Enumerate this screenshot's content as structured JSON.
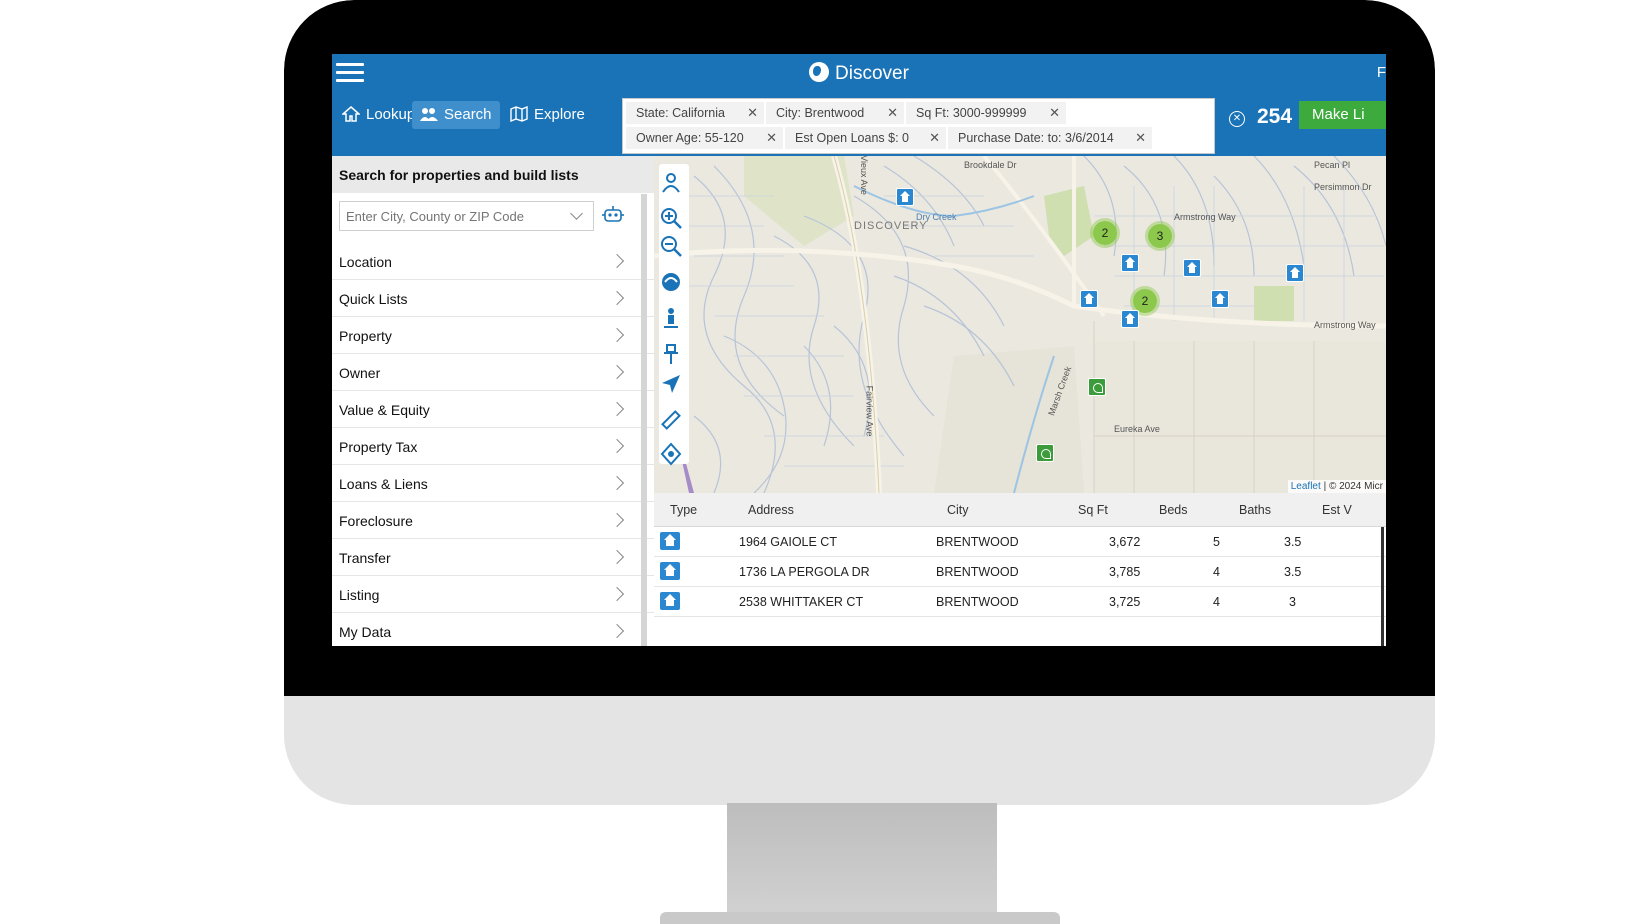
{
  "app": {
    "title": "Discover",
    "top_right_text": "F"
  },
  "nav": {
    "tabs": [
      {
        "label": "Lookup",
        "icon": "home-icon"
      },
      {
        "label": "Search",
        "icon": "search-people-icon",
        "active": true
      },
      {
        "label": "Explore",
        "icon": "map-explore-icon"
      }
    ]
  },
  "filters": [
    {
      "label": "State: California"
    },
    {
      "label": "City: Brentwood"
    },
    {
      "label": "Sq Ft: 3000-999999"
    },
    {
      "label": "Owner Age: 55-120"
    },
    {
      "label": "Est Open Loans $: 0"
    },
    {
      "label": "Purchase Date: to: 3/6/2014"
    }
  ],
  "results_count": "254",
  "make_list_label": "Make Li",
  "left_panel": {
    "header": "Search for properties and build lists",
    "search_placeholder": "Enter City, County or ZIP Code",
    "menu": [
      "Location",
      "Quick Lists",
      "Property",
      "Owner",
      "Value & Equity",
      "Property Tax",
      "Loans & Liens",
      "Foreclosure",
      "Transfer",
      "Listing",
      "My Data"
    ]
  },
  "map": {
    "clusters": [
      "2",
      "3",
      "2"
    ],
    "labels": [
      "Brookdale Dr",
      "Vieux Ave",
      "Dry Creek",
      "DISCOVERY",
      "Armstrong Way",
      "Armstrong Way",
      "Fairview Ave",
      "Marsh Creek",
      "Eureka Ave",
      "Pecan Pl",
      "Persimmon Dr"
    ],
    "attribution_link": "Leaflet",
    "attribution_text": "| © 2024 Micr"
  },
  "table": {
    "columns": [
      "Type",
      "Address",
      "City",
      "Sq Ft",
      "Beds",
      "Baths",
      "Est V"
    ],
    "rows": [
      {
        "address": "1964 GAIOLE CT",
        "city": "BRENTWOOD",
        "sqft": "3,672",
        "beds": "5",
        "baths": "3.5"
      },
      {
        "address": "1736 LA PERGOLA DR",
        "city": "BRENTWOOD",
        "sqft": "3,785",
        "beds": "4",
        "baths": "3.5"
      },
      {
        "address": "2538 WHITTAKER CT",
        "city": "BRENTWOOD",
        "sqft": "3,725",
        "beds": "4",
        "baths": "3"
      }
    ]
  },
  "colors": {
    "primary": "#1a73b7",
    "accent_green": "#3caa3c",
    "cluster_green": "#8cc84b",
    "pin_blue": "#2c87d1"
  }
}
